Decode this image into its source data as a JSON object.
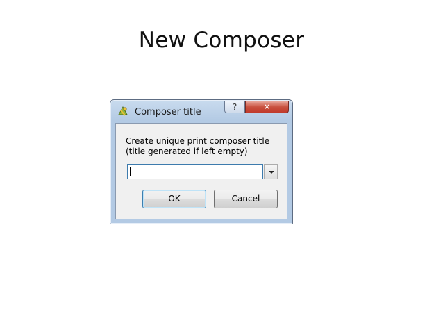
{
  "slide": {
    "title": "New Composer"
  },
  "dialog": {
    "title": "Composer title",
    "icon": "qgis-logo-icon",
    "help_label": "?",
    "close_label": "✕",
    "prompt_line1": "Create unique print composer title",
    "prompt_line2": "(title generated if left empty)",
    "input": {
      "value": "",
      "placeholder": ""
    },
    "ok_label": "OK",
    "cancel_label": "Cancel"
  }
}
